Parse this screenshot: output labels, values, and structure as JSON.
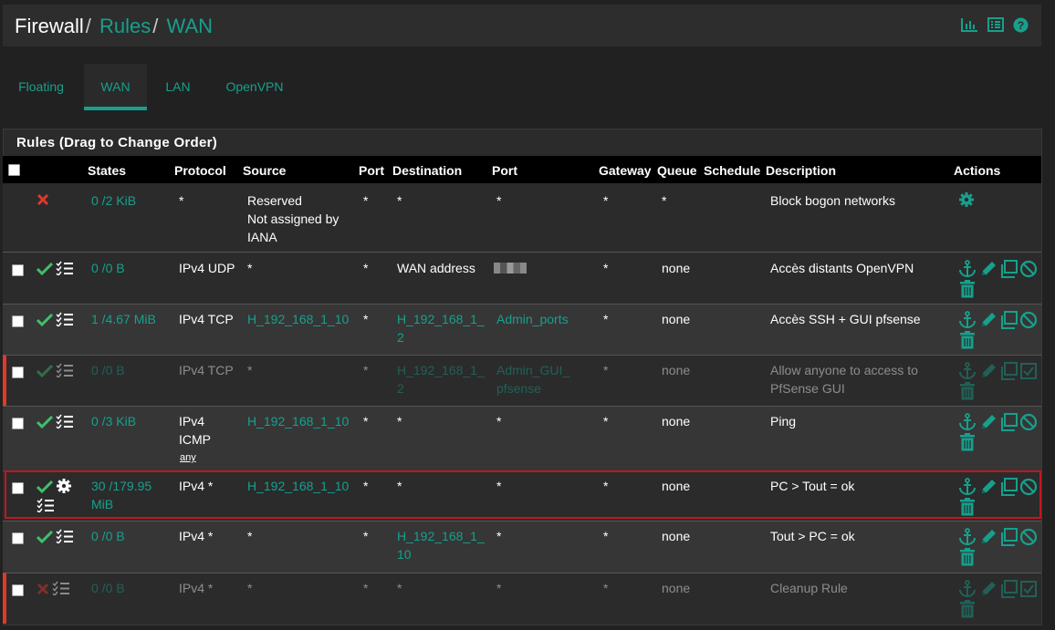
{
  "breadcrumb": {
    "root": "Firewall",
    "sep1": "/",
    "section": "Rules",
    "sep2": "/",
    "current": "WAN"
  },
  "header_icons": [
    "chart-icon",
    "list-icon",
    "help-icon"
  ],
  "tabs": [
    {
      "label": "Floating"
    },
    {
      "label": "WAN"
    },
    {
      "label": "LAN"
    },
    {
      "label": "OpenVPN"
    }
  ],
  "panel": {
    "title": "Rules (Drag to Change Order)"
  },
  "columns": {
    "states": "States",
    "protocol": "Protocol",
    "source": "Source",
    "port": "Port",
    "destination": "Destination",
    "dport": "Port",
    "gateway": "Gateway",
    "queue": "Queue",
    "schedule": "Schedule",
    "description": "Description",
    "actions": "Actions"
  },
  "rows": [
    {
      "states": "0 /2 KiB",
      "protocol": "*",
      "source_l1": "Reserved",
      "source_l2": "Not assigned by",
      "source_l3": "IANA",
      "port": "*",
      "destination": "*",
      "dport": "*",
      "gateway": "*",
      "queue": "*",
      "description": "Block bogon networks"
    },
    {
      "states": "0 /0 B",
      "protocol": "IPv4 UDP",
      "source": "*",
      "port": "*",
      "destination": "WAN address",
      "gateway": "*",
      "queue": "none",
      "description": "Accès distants OpenVPN"
    },
    {
      "states": "1 /4.67 MiB",
      "protocol": "IPv4 TCP",
      "source": "H_192_168_1_10",
      "port": "*",
      "destination_l1": "H_192_168_1_",
      "destination_l2": "2",
      "dport": "Admin_ports",
      "gateway": "*",
      "queue": "none",
      "description": "Accès SSH + GUI pfsense"
    },
    {
      "states": "0 /0 B",
      "protocol": "IPv4 TCP",
      "source": "*",
      "port": "*",
      "destination_l1": "H_192_168_1_",
      "destination_l2": "2",
      "dport_l1": "Admin_GUI_",
      "dport_l2": "pfsense",
      "gateway": "*",
      "queue": "none",
      "description_l1": "Allow anyone to access to",
      "description_l2": "PfSense GUI"
    },
    {
      "states": "0 /3 KiB",
      "protocol_l1": "IPv4",
      "protocol_l2": "ICMP",
      "protocol_l3": "any",
      "source": "H_192_168_1_10",
      "port": "*",
      "destination": "*",
      "dport": "*",
      "gateway": "*",
      "queue": "none",
      "description": "Ping"
    },
    {
      "states_l1": "30 /179.95",
      "states_l2": "MiB",
      "protocol": "IPv4 *",
      "source": "H_192_168_1_10",
      "port": "*",
      "destination": "*",
      "dport": "*",
      "gateway": "*",
      "queue": "none",
      "description": "PC > Tout = ok"
    },
    {
      "states": "0 /0 B",
      "protocol": "IPv4 *",
      "source": "*",
      "port": "*",
      "destination_l1": "H_192_168_1_",
      "destination_l2": "10",
      "dport": "*",
      "gateway": "*",
      "queue": "none",
      "description": "Tout > PC = ok"
    },
    {
      "states": "0 /0 B",
      "protocol": "IPv4 *",
      "source": "*",
      "port": "*",
      "destination": "*",
      "dport": "*",
      "gateway": "*",
      "queue": "none",
      "description": "Cleanup Rule"
    }
  ],
  "colors": {
    "accent": "#17a08c",
    "block": "#e0392b",
    "pass": "#3fbf6a",
    "selected_border": "#c0181f"
  }
}
